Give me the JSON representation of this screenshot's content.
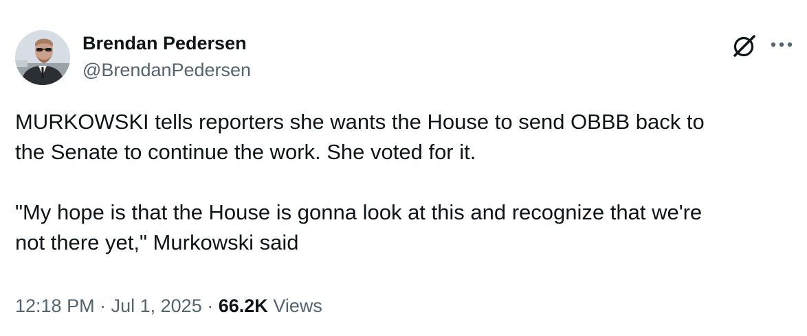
{
  "author": {
    "display_name": "Brendan Pedersen",
    "handle": "@BrendanPedersen",
    "avatar_icon": "profile-photo"
  },
  "tweet": {
    "paragraphs": [
      "MURKOWSKI tells reporters she wants the House to send OBBB back to\nthe Senate to continue the work. She voted for it.",
      "\"My hope is that the House is gonna look at this and recognize that we're\nnot there yet,\" Murkowski said"
    ]
  },
  "meta": {
    "time": "12:18 PM",
    "separator": "·",
    "date": "Jul 1, 2025",
    "views_count": "66.2K",
    "views_label": "Views"
  },
  "icons": {
    "grok": "grok-icon",
    "more": "more-options-icon"
  },
  "colors": {
    "text_primary": "#0f1419",
    "text_secondary": "#536471",
    "background": "#ffffff"
  }
}
